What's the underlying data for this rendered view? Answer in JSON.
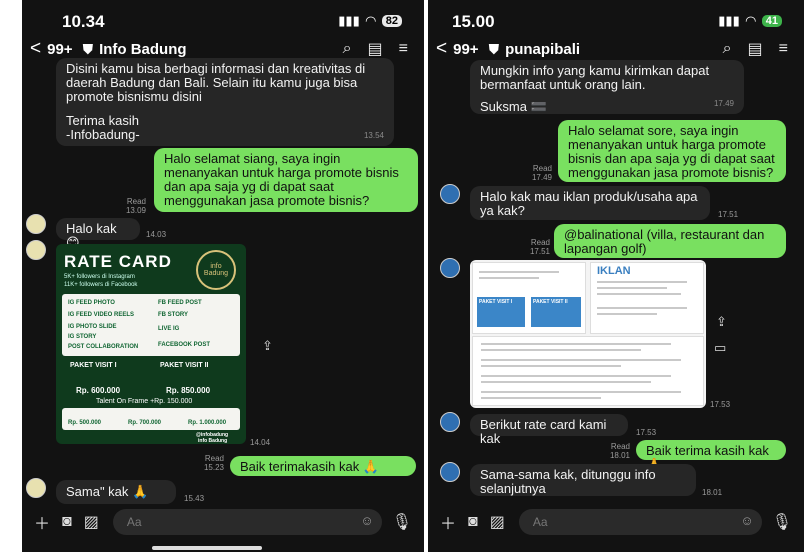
{
  "left": {
    "status": {
      "time": "10.34",
      "battery": "82"
    },
    "header": {
      "back": "<",
      "count": "99+",
      "title": "Info Badung"
    },
    "msgs": {
      "m1": "Disini kamu bisa berbagi informasi dan kreativitas di daerah Badung dan Bali. Selain itu kamu juga bisa promote bisnismu disini",
      "m1b": "Terima kasih",
      "m1c": "-Infobadung-",
      "m1_time": "13.54",
      "m2": "Halo selamat siang, saya ingin menanyakan untuk harga promote bisnis dan apa saja yg di dapat saat menggunakan jasa promote bisnis?",
      "m2_read": "Read",
      "m2_time": "13.09",
      "m3": "Halo kak",
      "m3_emoji": "😊",
      "m3_time": "14.03",
      "m4_time": "14.04",
      "m5": "Baik terimakasih kak",
      "m5_emoji": "🙏",
      "m5_read": "Read",
      "m5_time": "15.23",
      "m6": "Sama\" kak",
      "m6_emoji": "🙏",
      "m6_time": "15.43"
    },
    "ratecard": {
      "title": "RATE CARD",
      "ig": "5K+ followers di Instagram",
      "fb": "11K+ followers di Facebook",
      "seal": "info Badung",
      "items": [
        "IG FEED PHOTO",
        "FB FEED POST",
        "IG FEED VIDEO REELS",
        "FB STORY",
        "IG PHOTO SLIDE",
        "IG STORY",
        "LIVE IG",
        "POST COLLABORATION",
        "FACEBOOK POST"
      ],
      "paket1": "PAKET VISIT I",
      "paket2": "PAKET VISIT II",
      "price1": "Rp. 600.000",
      "price2": "Rp. 850.000",
      "talent": "Talent On Frame +Rp. 150.000",
      "review_prices": [
        "Rp. 500.000",
        "Rp. 700.000",
        "Rp. 1.000.000"
      ],
      "footer": "@infobadung",
      "footer2": "info Badung"
    },
    "input": {
      "placeholder": "Aa"
    }
  },
  "right": {
    "status": {
      "time": "15.00",
      "battery": "41"
    },
    "header": {
      "back": "<",
      "count": "99+",
      "title": "punapibali"
    },
    "msgs": {
      "r1": "Mungkin info yang kamu kirimkan dapat bermanfaat untuk orang lain.",
      "r1b": "Suksma",
      "r1_emoji": "🟰",
      "r1_time": "17.49",
      "r2": "Halo selamat sore, saya ingin menanyakan untuk harga promote bisnis dan apa saja yg di dapat saat menggunakan jasa promote bisnis?",
      "r2_read": "Read",
      "r2_time": "17.49",
      "r3": "Halo kak mau iklan produk/usaha apa ya kak?",
      "r3_time": "17.51",
      "r4": "@balinational (villa, restaurant dan lapangan golf)",
      "r4_read": "Read",
      "r4_time": "17.51",
      "r5_time": "17.53",
      "r6": "Berikut rate card kami kak",
      "r6_time": "17.53",
      "r7": "Baik terima kasih kak",
      "r7_emoji": "🙏",
      "r7_read": "Read",
      "r7_time": "18.01",
      "r8": "Sama-sama kak, ditunggu info selanjutnya",
      "r8_time": "18.01"
    },
    "docs": {
      "iklan": "IKLAN",
      "paket1": "PAKET VISIT I",
      "paket2": "PAKET VISIT II"
    },
    "input": {
      "placeholder": "Aa"
    }
  }
}
